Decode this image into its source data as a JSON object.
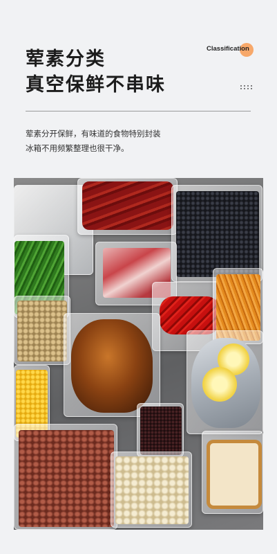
{
  "heading": {
    "line1": "荤素分类",
    "line2": "真空保鲜不串味",
    "badge": "Classification"
  },
  "description": {
    "line1": "荤素分开保鲜，有味道的食物特别封装",
    "line2": "冰箱不用频繁整理也很干净。"
  },
  "colors": {
    "background": "#f1f2f4",
    "accent": "#f7a86a",
    "title": "#1c1c1c"
  },
  "photo": {
    "subject": "vacuum-sealed-food-bags",
    "items": [
      "sausage",
      "black-beans",
      "raw-meat",
      "chili-peppers",
      "carrot-strips",
      "green-chives",
      "soybeans",
      "roast-chicken",
      "fish-with-lemon",
      "corn",
      "red-beans",
      "black-rice",
      "lotus-seeds",
      "bread",
      "plastic-film"
    ]
  }
}
